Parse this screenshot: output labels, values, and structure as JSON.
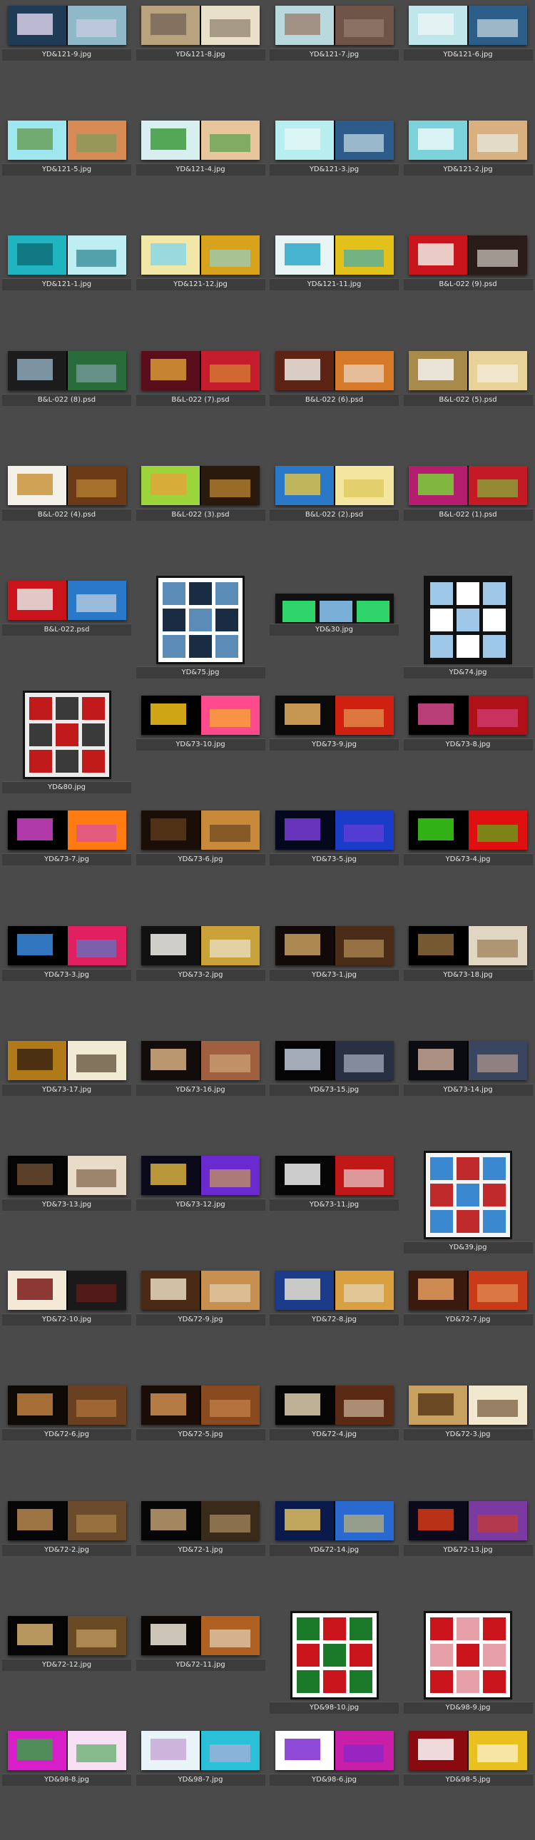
{
  "rows": [
    [
      {
        "label": "YD&121-9.jpg",
        "colors": [
          "#1f3b56",
          "#8fb8c9",
          "#d8d0e8"
        ],
        "shape": "spread"
      },
      {
        "label": "YD&121-8.jpg",
        "colors": [
          "#b9a37f",
          "#e8e0c8",
          "#7a6a5a"
        ],
        "shape": "spread"
      },
      {
        "label": "YD&121-7.jpg",
        "colors": [
          "#b9d9dc",
          "#6e5446",
          "#9c8576"
        ],
        "shape": "spread"
      },
      {
        "label": "YD&121-6.jpg",
        "colors": [
          "#bfe6ea",
          "#2c5e88",
          "#e9f4f5"
        ],
        "shape": "spread"
      }
    ],
    [
      {
        "label": "YD&121-5.jpg",
        "colors": [
          "#9fe7ef",
          "#d68b55",
          "#6aa05c"
        ],
        "shape": "spread"
      },
      {
        "label": "YD&121-4.jpg",
        "colors": [
          "#d7f0ef",
          "#e8c59d",
          "#3c9a3b"
        ],
        "shape": "spread"
      },
      {
        "label": "YD&121-3.jpg",
        "colors": [
          "#b9eef0",
          "#2c5b8c",
          "#e2f7f7"
        ],
        "shape": "spread"
      },
      {
        "label": "YD&121-2.jpg",
        "colors": [
          "#7cd3dc",
          "#d9b07f",
          "#eaf7f7"
        ],
        "shape": "spread"
      }
    ],
    [
      {
        "label": "YD&121-1.jpg",
        "colors": [
          "#1fb4c0",
          "#bfeef2",
          "#0e6f78"
        ],
        "shape": "spread"
      },
      {
        "label": "YD&121-12.jpg",
        "colors": [
          "#f1e7a6",
          "#d8a31a",
          "#8bd7e5"
        ],
        "shape": "spread"
      },
      {
        "label": "YD&121-11.jpg",
        "colors": [
          "#e8f3f4",
          "#e2c21a",
          "#2aa7c8"
        ],
        "shape": "spread"
      },
      {
        "label": "B&L-022 (9).psd",
        "colors": [
          "#c8141a",
          "#2a1c18",
          "#f1ebe4"
        ],
        "shape": "spread"
      }
    ],
    [
      {
        "label": "B&L-022 (8).psd",
        "colors": [
          "#1c1c1c",
          "#2a6b3c",
          "#8da8ba"
        ],
        "shape": "spread"
      },
      {
        "label": "B&L-022 (7).psd",
        "colors": [
          "#5a0d1b",
          "#c51d2e",
          "#d99a34"
        ],
        "shape": "spread"
      },
      {
        "label": "B&L-022 (6).psd",
        "colors": [
          "#5d2416",
          "#d47a2a",
          "#f0ebe5"
        ],
        "shape": "spread"
      },
      {
        "label": "B&L-022 (5).psd",
        "colors": [
          "#a88a4a",
          "#e7d29a",
          "#f5f3ee"
        ],
        "shape": "spread"
      }
    ],
    [
      {
        "label": "B&L-022 (4).psd",
        "colors": [
          "#f3f0ea",
          "#6b3b18",
          "#c9943b"
        ],
        "shape": "spread"
      },
      {
        "label": "B&L-022 (3).psd",
        "colors": [
          "#9bd43b",
          "#2a1a0e",
          "#e3a43a"
        ],
        "shape": "spread"
      },
      {
        "label": "B&L-022 (2).psd",
        "colors": [
          "#2a78c8",
          "#f2e6a0",
          "#d8c04a"
        ],
        "shape": "spread"
      },
      {
        "label": "B&L-022 (1).psd",
        "colors": [
          "#b51e6f",
          "#c41a26",
          "#76d23a"
        ],
        "shape": "spread"
      }
    ],
    [
      {
        "label": "B&L-022.psd",
        "colors": [
          "#c8141a",
          "#2a78c8",
          "#e6e6e6"
        ],
        "shape": "spread"
      },
      {
        "label": "YD&75.jpg",
        "colors": [
          "#ffffff",
          "#5b8cb8",
          "#1a2c44"
        ],
        "shape": "framed-sheet"
      },
      {
        "label": "YD&30.jpg",
        "colors": [
          "#111111",
          "#2fd46b",
          "#7ab0d8"
        ],
        "shape": "strip"
      },
      {
        "label": "YD&74.jpg",
        "colors": [
          "#111111",
          "#9fc7e8",
          "#ffffff"
        ],
        "shape": "framed-sheet"
      }
    ],
    [
      {
        "label": "YD&80.jpg",
        "colors": [
          "#ececec",
          "#c01a1a",
          "#3a3a3a"
        ],
        "shape": "framed-sheet"
      },
      {
        "label": "YD&73-10.jpg",
        "colors": [
          "#000000",
          "#ff4b8b",
          "#f3c21a"
        ],
        "shape": "spread"
      },
      {
        "label": "YD&73-9.jpg",
        "colors": [
          "#0a0a0a",
          "#d02010",
          "#e8b060"
        ],
        "shape": "spread"
      },
      {
        "label": "YD&73-8.jpg",
        "colors": [
          "#000000",
          "#b01018",
          "#d84a8a"
        ],
        "shape": "spread"
      }
    ],
    [
      {
        "label": "YD&73-7.jpg",
        "colors": [
          "#000000",
          "#ff7a10",
          "#d044c8"
        ],
        "shape": "spread"
      },
      {
        "label": "YD&73-6.jpg",
        "colors": [
          "#1a0e06",
          "#c88a3a",
          "#5a3a1a"
        ],
        "shape": "spread"
      },
      {
        "label": "YD&73-5.jpg",
        "colors": [
          "#04081c",
          "#1a3cc8",
          "#7a3cd8"
        ],
        "shape": "spread"
      },
      {
        "label": "YD&73-4.jpg",
        "colors": [
          "#000000",
          "#e01010",
          "#3ad01a"
        ],
        "shape": "spread"
      }
    ],
    [
      {
        "label": "YD&73-3.jpg",
        "colors": [
          "#000000",
          "#e02060",
          "#3a8ae0"
        ],
        "shape": "spread"
      },
      {
        "label": "YD&73-2.jpg",
        "colors": [
          "#111111",
          "#c9a23a",
          "#f2f0ea"
        ],
        "shape": "spread"
      },
      {
        "label": "YD&73-1.jpg",
        "colors": [
          "#110a08",
          "#4a2c18",
          "#c8a060"
        ],
        "shape": "spread"
      },
      {
        "label": "YD&73-18.jpg",
        "colors": [
          "#000000",
          "#e0d6c2",
          "#8a6a3a"
        ],
        "shape": "spread"
      }
    ],
    [
      {
        "label": "YD&73-17.jpg",
        "colors": [
          "#b07a18",
          "#f0ebd2",
          "#3a2410"
        ],
        "shape": "spread"
      },
      {
        "label": "YD&73-16.jpg",
        "colors": [
          "#120c0a",
          "#a06040",
          "#d8b080"
        ],
        "shape": "spread"
      },
      {
        "label": "YD&73-15.jpg",
        "colors": [
          "#050505",
          "#2a3044",
          "#c0c8d8"
        ],
        "shape": "spread"
      },
      {
        "label": "YD&73-14.jpg",
        "colors": [
          "#0a0c12",
          "#3a4660",
          "#c8a898"
        ],
        "shape": "spread"
      }
    ],
    [
      {
        "label": "YD&73-13.jpg",
        "colors": [
          "#050505",
          "#e8dcc8",
          "#6a4a30"
        ],
        "shape": "spread"
      },
      {
        "label": "YD&73-12.jpg",
        "colors": [
          "#0a0a1a",
          "#6a2ad0",
          "#d8b040"
        ],
        "shape": "spread"
      },
      {
        "label": "YD&73-11.jpg",
        "colors": [
          "#050505",
          "#c01818",
          "#f0f0f0"
        ],
        "shape": "spread"
      },
      {
        "label": "YD&39.jpg",
        "colors": [
          "#f4f4f4",
          "#3a88d0",
          "#c02a2a"
        ],
        "shape": "framed-sheet"
      }
    ],
    [
      {
        "label": "YD&72-10.jpg",
        "colors": [
          "#f2ead6",
          "#1a1a1a",
          "#7a1a1a"
        ],
        "shape": "spread"
      },
      {
        "label": "YD&72-9.jpg",
        "colors": [
          "#4a2a14",
          "#c89050",
          "#e8dcc0"
        ],
        "shape": "spread"
      },
      {
        "label": "YD&72-8.jpg",
        "colors": [
          "#1a3c8a",
          "#d8a040",
          "#e8e0d0"
        ],
        "shape": "spread"
      },
      {
        "label": "YD&72-7.jpg",
        "colors": [
          "#3a1a0c",
          "#c83a18",
          "#e8a060"
        ],
        "shape": "spread"
      }
    ],
    [
      {
        "label": "YD&72-6.jpg",
        "colors": [
          "#0e0a08",
          "#6a4020",
          "#c08040"
        ],
        "shape": "spread"
      },
      {
        "label": "YD&72-5.jpg",
        "colors": [
          "#1a0c06",
          "#8a4a20",
          "#d09050"
        ],
        "shape": "spread"
      },
      {
        "label": "YD&72-4.jpg",
        "colors": [
          "#050505",
          "#5a2a14",
          "#e0d0b0"
        ],
        "shape": "spread"
      },
      {
        "label": "YD&72-3.jpg",
        "colors": [
          "#c8a060",
          "#f2e8d0",
          "#5a3a1a"
        ],
        "shape": "spread"
      }
    ],
    [
      {
        "label": "YD&72-2.jpg",
        "colors": [
          "#060606",
          "#6a4a2a",
          "#b88a50"
        ],
        "shape": "spread"
      },
      {
        "label": "YD&72-1.jpg",
        "colors": [
          "#050505",
          "#3a2a1a",
          "#c0a070"
        ],
        "shape": "spread"
      },
      {
        "label": "YD&72-14.jpg",
        "colors": [
          "#0a1a4a",
          "#2a6ad0",
          "#e0c060"
        ],
        "shape": "spread"
      },
      {
        "label": "YD&72-13.jpg",
        "colors": [
          "#0a0a1a",
          "#7a3aa0",
          "#d83a18"
        ],
        "shape": "spread"
      }
    ],
    [
      {
        "label": "YD&72-12.jpg",
        "colors": [
          "#050505",
          "#6a4a24",
          "#d8b070"
        ],
        "shape": "spread"
      },
      {
        "label": "YD&72-11.jpg",
        "colors": [
          "#0a0604",
          "#b06020",
          "#f0e8d8"
        ],
        "shape": "spread"
      },
      {
        "label": "YD&98-10.jpg",
        "colors": [
          "#ffffff",
          "#1a7a2a",
          "#c8141a"
        ],
        "shape": "framed-sheet"
      },
      {
        "label": "YD&98-9.jpg",
        "colors": [
          "#ffffff",
          "#c8141a",
          "#e8a0a8"
        ],
        "shape": "framed-sheet"
      }
    ],
    [
      {
        "label": "YD&98-8.jpg",
        "colors": [
          "#d81ec8",
          "#f8e0f4",
          "#3aa048"
        ],
        "shape": "spread"
      },
      {
        "label": "YD&98-7.jpg",
        "colors": [
          "#e8f4f8",
          "#2ac0d8",
          "#c8a8d8"
        ],
        "shape": "spread"
      },
      {
        "label": "YD&98-6.jpg",
        "colors": [
          "#ffffff",
          "#c81ea8",
          "#7a2ad0"
        ],
        "shape": "spread"
      },
      {
        "label": "YD&98-5.jpg",
        "colors": [
          "#8a0a10",
          "#e8c020",
          "#ffffff"
        ],
        "shape": "spread"
      }
    ]
  ]
}
